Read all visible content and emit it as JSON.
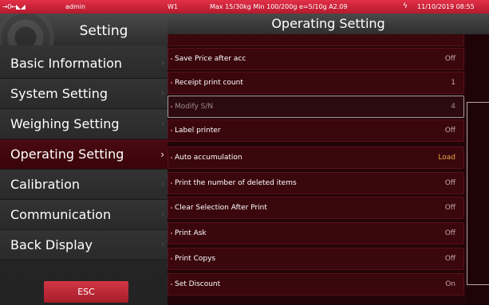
{
  "status_bar": {
    "icons": "→0←◣◢",
    "user": "admin",
    "scale": "W1",
    "spec": "Max 15/30kg  Min 100/200g e=5/10g A2.09",
    "bolt": "ϟ",
    "datetime": "11/10/2019 08:55"
  },
  "sidebar": {
    "title": "Setting",
    "items": [
      {
        "label": "Basic Information"
      },
      {
        "label": "System Setting"
      },
      {
        "label": "Weighing Setting"
      },
      {
        "label": "Operating Setting",
        "active": true
      },
      {
        "label": "Calibration"
      },
      {
        "label": "Communication"
      },
      {
        "label": "Back Display"
      }
    ],
    "chevron": "›",
    "esc_label": "ESC"
  },
  "main": {
    "title": "Operating Setting",
    "rows": [
      {
        "label": "",
        "value": ""
      },
      {
        "label": "Save Price after acc",
        "value": "Off"
      },
      {
        "label": "Receipt print count",
        "value": "1"
      },
      {
        "label": "Modify S/N",
        "value": "4",
        "state": "disabled"
      },
      {
        "label": "Label printer",
        "value": "Off"
      },
      {
        "label": "Auto accumulation",
        "value": "Load",
        "state": "highlight"
      },
      {
        "label": "Print the number of deleted items",
        "value": "Off"
      },
      {
        "label": "Clear Selection After Print",
        "value": "Off"
      },
      {
        "label": "Print Ask",
        "value": "Off"
      },
      {
        "label": "Print Copys",
        "value": "Off"
      },
      {
        "label": "Set Discount",
        "value": "On"
      }
    ]
  },
  "colors": {
    "accent": "#c8283c",
    "panel_bg": "#220508",
    "row_bg": "#3a070d",
    "highlight_value": "#e9a84a"
  }
}
